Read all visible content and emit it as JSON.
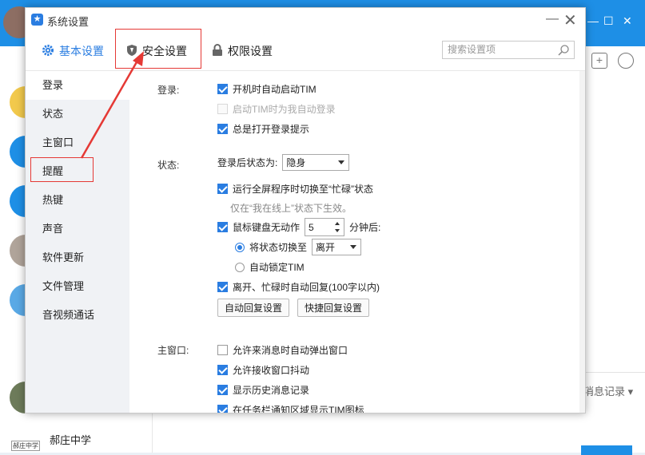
{
  "dialog": {
    "title": "系统设置",
    "tabs": [
      {
        "label": "基本设置",
        "icon": "gear-icon"
      },
      {
        "label": "安全设置",
        "icon": "shield-icon"
      },
      {
        "label": "权限设置",
        "icon": "lock-icon"
      }
    ],
    "search_placeholder": "搜索设置项"
  },
  "sidebar": {
    "items": [
      "登录",
      "状态",
      "主窗口",
      "提醒",
      "热键",
      "声音",
      "软件更新",
      "文件管理",
      "音视频通话"
    ],
    "active": "登录"
  },
  "login": {
    "label": "登录:",
    "options": [
      {
        "text": "开机时自动启动TIM",
        "checked": true,
        "disabled": false
      },
      {
        "text": "启动TIM时为我自动登录",
        "checked": false,
        "disabled": true
      },
      {
        "text": "总是打开登录提示",
        "checked": true,
        "disabled": false
      }
    ]
  },
  "status": {
    "label": "状态:",
    "after_login_label": "登录后状态为:",
    "after_login_value": "隐身",
    "fullscreen_busy": "运行全屏程序时切换至“忙碌”状态",
    "fullscreen_hint": "仅在“我在线上”状态下生效。",
    "idle_prefix": "鼠标键盘无动作",
    "idle_minutes": "5",
    "idle_suffix": "分钟后:",
    "switch_label": "将状态切换至",
    "switch_value": "离开",
    "auto_lock": "自动锁定TIM",
    "auto_reply": "离开、忙碌时自动回复(100字以内)",
    "auto_reply_btn": "自动回复设置",
    "quick_reply_btn": "快捷回复设置"
  },
  "main_window": {
    "label": "主窗口:",
    "options": [
      {
        "text": "允许来消息时自动弹出窗口",
        "checked": false
      },
      {
        "text": "允许接收窗口抖动",
        "checked": true
      },
      {
        "text": "显示历史消息记录",
        "checked": true
      },
      {
        "text": "在任务栏通知区域显示TIM图标",
        "checked": true
      }
    ]
  },
  "background": {
    "school_name": "郝庄中学",
    "school_badge": "郝庄中学",
    "msg_history": "消息记录"
  },
  "colors": {
    "accent": "#2a7de1",
    "annotation": "#e53935"
  }
}
